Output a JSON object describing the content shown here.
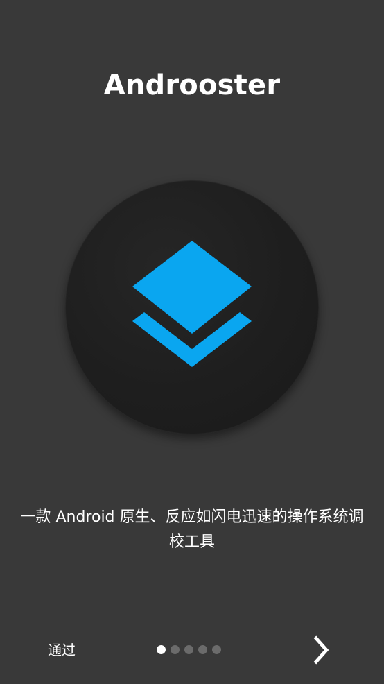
{
  "app": {
    "title": "Androoster"
  },
  "logo": {
    "icon": "layers-icon",
    "color": "#0aa6f0"
  },
  "intro": {
    "tagline": "一款 Android 原生、反应如闪电迅速的操作系统调校工具"
  },
  "footer": {
    "skip_label": "通过",
    "next_icon": "chevron-right-icon",
    "page_count": 5,
    "active_page": 1
  }
}
